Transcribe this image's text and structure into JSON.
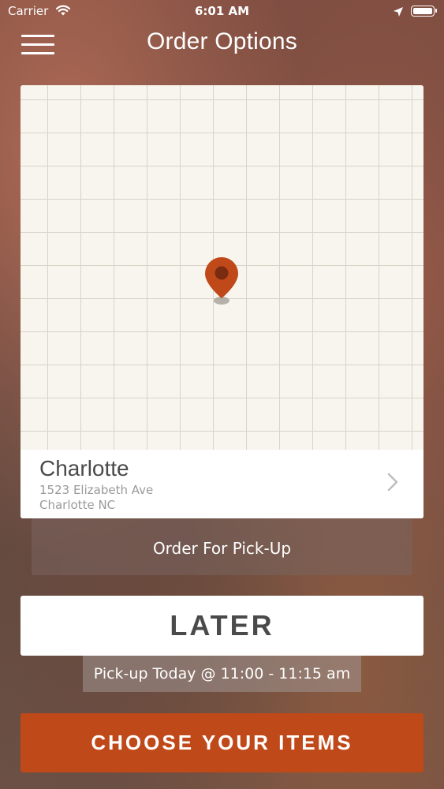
{
  "status_bar": {
    "carrier": "Carrier",
    "time": "6:01 AM",
    "icons": [
      "wifi-icon",
      "location-arrow-icon",
      "battery-icon"
    ]
  },
  "nav": {
    "title": "Order Options",
    "menu_icon": "hamburger-menu-icon"
  },
  "location": {
    "name": "Charlotte",
    "address_line1": "1523 Elizabeth Ave",
    "address_line2": "Charlotte NC",
    "pin_icon": "map-pin-icon"
  },
  "order_type": {
    "label": "Order For Pick-Up"
  },
  "time_selector": {
    "label": "LATER",
    "pickup_time": "Pick-up Today @ 11:00 - 11:15 am"
  },
  "cta": {
    "label": "CHOOSE YOUR ITEMS"
  },
  "colors": {
    "accent": "#c0491a",
    "pin": "#c0491a",
    "map_background": "#f8f5ee"
  }
}
